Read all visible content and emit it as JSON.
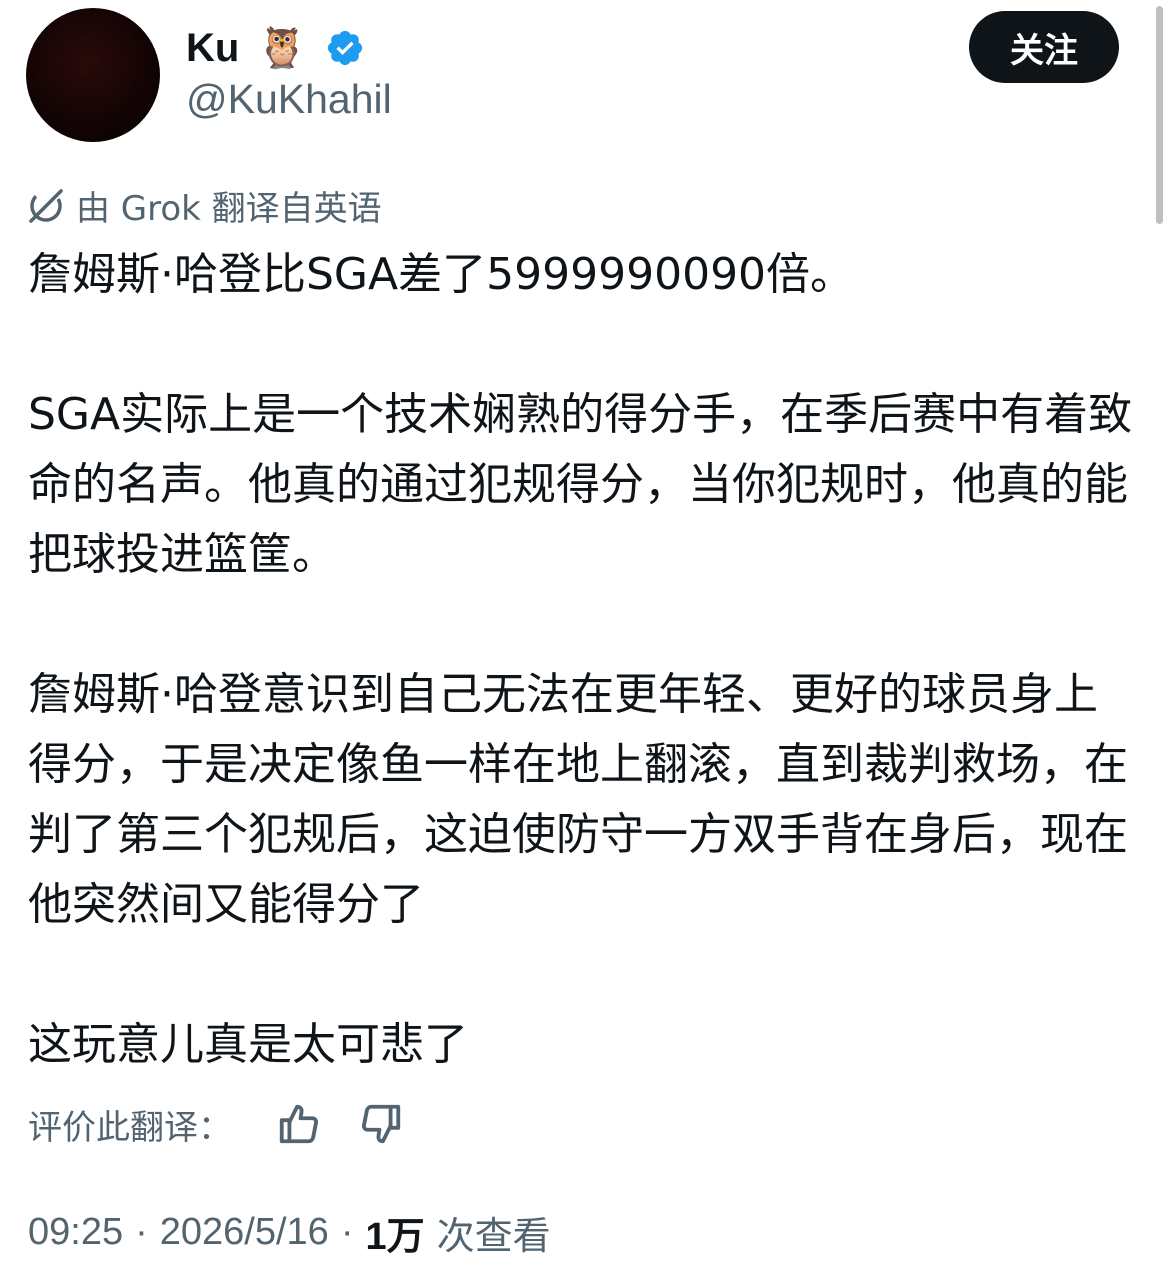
{
  "header": {
    "display_name": "Ku",
    "emoji": "🦉",
    "handle": "@KuKhahil",
    "follow_label": "关注",
    "verified_color": "#1d9bf0",
    "icons": [
      "owl-emoji",
      "verified-badge-icon"
    ]
  },
  "translation": {
    "note": "由 Grok 翻译自英语",
    "icon": "grok-icon"
  },
  "tweet": {
    "paragraphs": [
      "詹姆斯·哈登比SGA差了5999990090倍。",
      "SGA实际上是一个技术娴熟的得分手，在季后赛中有着致命的名声。他真的通过犯规得分，当你犯规时，他真的能把球投进篮筐。",
      "詹姆斯·哈登意识到自己无法在更年轻、更好的球员身上得分，于是决定像鱼一样在地上翻滚，直到裁判救场，在判了第三个犯规后，这迫使防守一方双手背在身后，现在他突然间又能得分了",
      "这玩意儿真是太可悲了"
    ]
  },
  "rating": {
    "label": "评价此翻译：",
    "icons": [
      "thumbs-up-icon",
      "thumbs-down-icon"
    ]
  },
  "meta": {
    "time": "09:25",
    "date": "2026/5/16",
    "views_count": "1万",
    "views_label": "次查看",
    "separator": "·"
  }
}
